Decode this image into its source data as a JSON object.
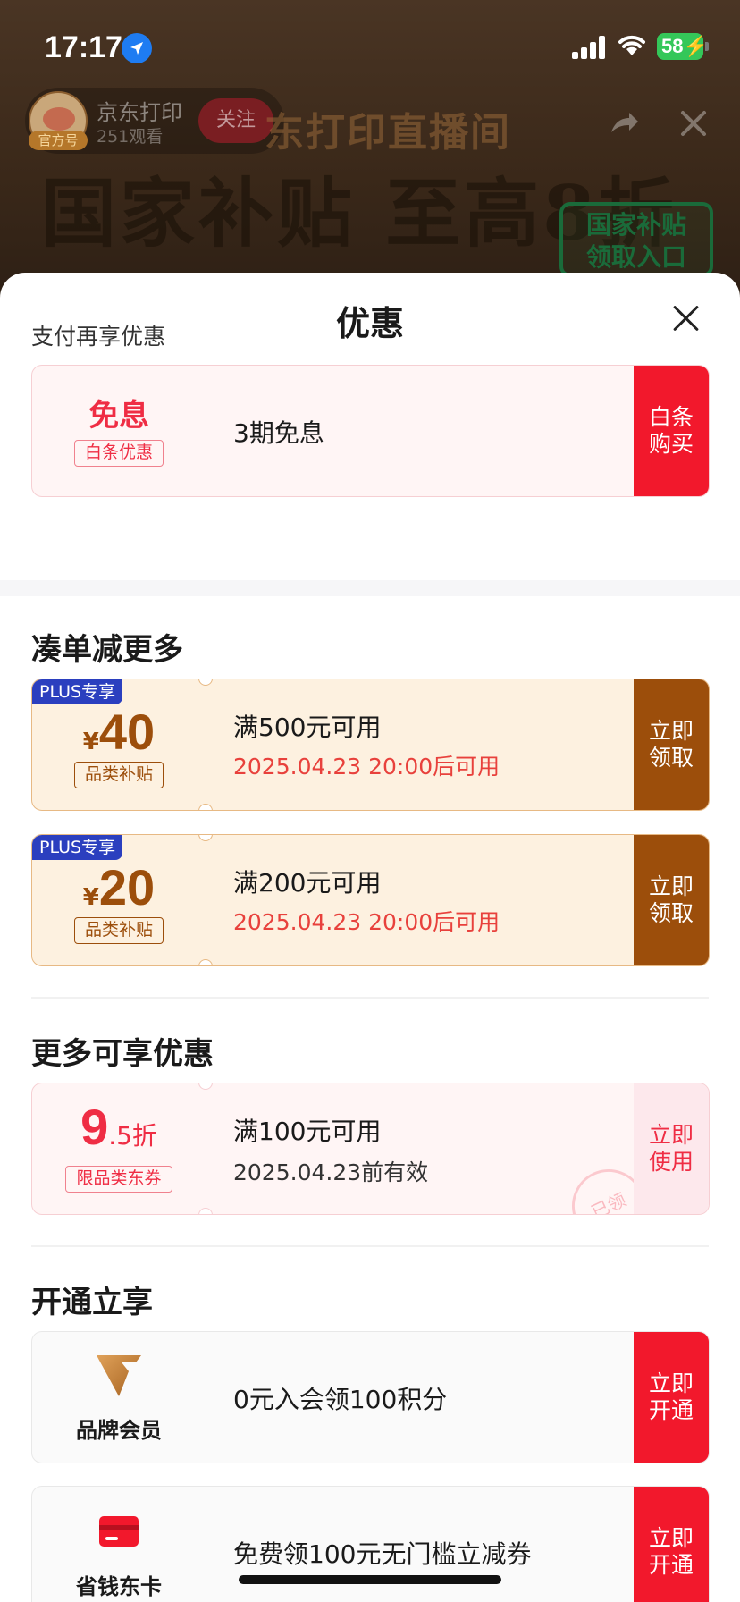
{
  "status": {
    "time": "17:17",
    "battery": "58"
  },
  "live": {
    "anchor_name": "京东打印",
    "viewers": "251观看",
    "official_tag": "官方号",
    "follow_label": "关注",
    "room_title": "东打印直播间",
    "banner": "国家补贴 至高8折",
    "badge_line1": "国家补贴",
    "badge_line2": "领取入口"
  },
  "sheet": {
    "title": "优惠",
    "pay_section": "支付再享优惠",
    "bundle_section": "凑单减更多",
    "more_section": "更多可享优惠",
    "open_section": "开通立享"
  },
  "coupons": {
    "baitiao": {
      "headline": "免息",
      "tag": "白条优惠",
      "desc": "3期免息",
      "btn1": "白条",
      "btn2": "购买"
    },
    "plus40": {
      "plus_tag": "PLUS专享",
      "yen": "¥",
      "amount": "40",
      "tag": "品类补贴",
      "desc": "满500元可用",
      "time": "2025.04.23 20:00后可用",
      "btn1": "立即",
      "btn2": "领取"
    },
    "plus20": {
      "plus_tag": "PLUS专享",
      "yen": "¥",
      "amount": "20",
      "tag": "品类补贴",
      "desc": "满200元可用",
      "time": "2025.04.23 20:00后可用",
      "btn1": "立即",
      "btn2": "领取"
    },
    "discount": {
      "big": "9",
      "small": ".5折",
      "tag": "限品类东券",
      "desc": "满100元可用",
      "time": "2025.04.23前有效",
      "btn1": "立即",
      "btn2": "使用",
      "stamp": "已领"
    },
    "brand_member": {
      "label": "品牌会员",
      "desc": "0元入会领100积分",
      "btn1": "立即",
      "btn2": "开通"
    },
    "saver_card": {
      "label": "省钱东卡",
      "desc": "免费领100元无门槛立减券",
      "btn1": "立即",
      "btn2": "开通"
    }
  },
  "colors": {
    "accent_red": "#f2182c",
    "coupon_brown": "#9c4e0b",
    "plus_blue": "#2b3fbf"
  }
}
